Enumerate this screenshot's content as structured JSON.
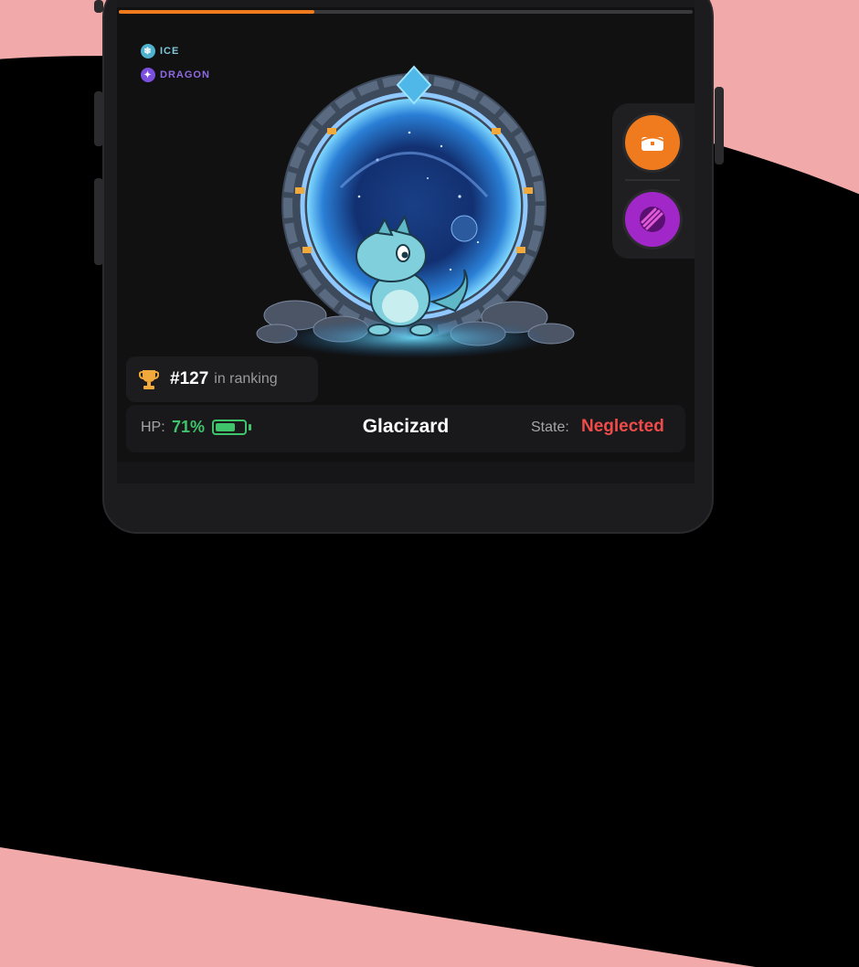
{
  "progress": {
    "value": 0.34
  },
  "types": [
    {
      "label": "ICE",
      "icon": "snowflake-icon",
      "color": "#7fc8d9",
      "dot": "#4fb3cf"
    },
    {
      "label": "DRAGON",
      "icon": "dragon-icon",
      "color": "#8e6ae0",
      "dot": "#7b4fe0"
    }
  ],
  "actions": [
    {
      "icon": "chest-icon",
      "color": "#f07b1f"
    },
    {
      "icon": "claw-slash-icon",
      "color": "#a227c9"
    }
  ],
  "ranking": {
    "number": "#127",
    "suffix": "in ranking",
    "icon": "trophy-icon"
  },
  "status": {
    "hp_label": "HP:",
    "hp_value": "71%",
    "hp_fraction": 0.71,
    "name": "Glacizard",
    "state_label": "State:",
    "state_value": "Neglected"
  },
  "colors": {
    "accent": "#f07b1f",
    "hp": "#3fc46b",
    "danger": "#ef4b4b"
  }
}
